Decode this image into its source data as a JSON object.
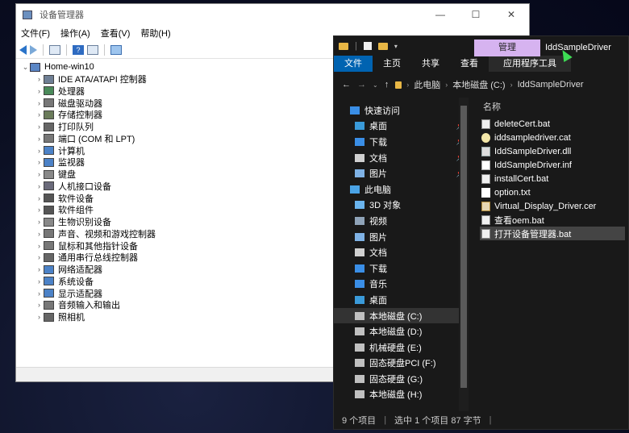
{
  "device_manager": {
    "title": "设备管理器",
    "controls": {
      "minimize": "—",
      "maximize": "☐",
      "close": "✕"
    },
    "menu": [
      "文件(F)",
      "操作(A)",
      "查看(V)",
      "帮助(H)"
    ],
    "root": "Home-win10",
    "categories": [
      "IDE ATA/ATAPI 控制器",
      "处理器",
      "磁盘驱动器",
      "存储控制器",
      "打印队列",
      "端口 (COM 和 LPT)",
      "计算机",
      "监视器",
      "键盘",
      "人机接口设备",
      "软件设备",
      "软件组件",
      "生物识别设备",
      "声音、视频和游戏控制器",
      "鼠标和其他指针设备",
      "通用串行总线控制器",
      "网络适配器",
      "系统设备",
      "显示适配器",
      "音频输入和输出",
      "照相机"
    ]
  },
  "explorer": {
    "manage_tab": "管理",
    "title": "IddSampleDriver",
    "ribbon": [
      "文件",
      "主页",
      "共享",
      "查看",
      "应用程序工具"
    ],
    "breadcrumb": [
      "此电脑",
      "本地磁盘 (C:)",
      "IddSampleDriver"
    ],
    "column_header": "名称",
    "nav": {
      "quick_access": "快速访问",
      "quick_items": [
        "桌面",
        "下载",
        "文档",
        "图片"
      ],
      "this_pc": "此电脑",
      "pc_items": [
        "3D 对象",
        "视频",
        "图片",
        "文档",
        "下载",
        "音乐",
        "桌面",
        "本地磁盘 (C:)",
        "本地磁盘 (D:)",
        "机械硬盘 (E:)",
        "固态硬盘PCI (F:)",
        "固态硬盘 (G:)",
        "本地磁盘 (H:)"
      ]
    },
    "files": [
      {
        "name": "deleteCert.bat",
        "icon": "bat-file-icon"
      },
      {
        "name": "iddsampledriver.cat",
        "icon": "cat-file-icon"
      },
      {
        "name": "IddSampleDriver.dll",
        "icon": "dll-file-icon"
      },
      {
        "name": "IddSampleDriver.inf",
        "icon": "inf-file-icon"
      },
      {
        "name": "installCert.bat",
        "icon": "bat-file-icon"
      },
      {
        "name": "option.txt",
        "icon": "txt-file-icon"
      },
      {
        "name": "Virtual_Display_Driver.cer",
        "icon": "cer-file-icon"
      },
      {
        "name": "查看oem.bat",
        "icon": "bat-file-icon"
      },
      {
        "name": "打开设备管理器.bat",
        "icon": "bat-file-icon"
      }
    ],
    "status": {
      "count": "9 个项目",
      "selected": "选中 1 个项目  87 字节"
    }
  }
}
